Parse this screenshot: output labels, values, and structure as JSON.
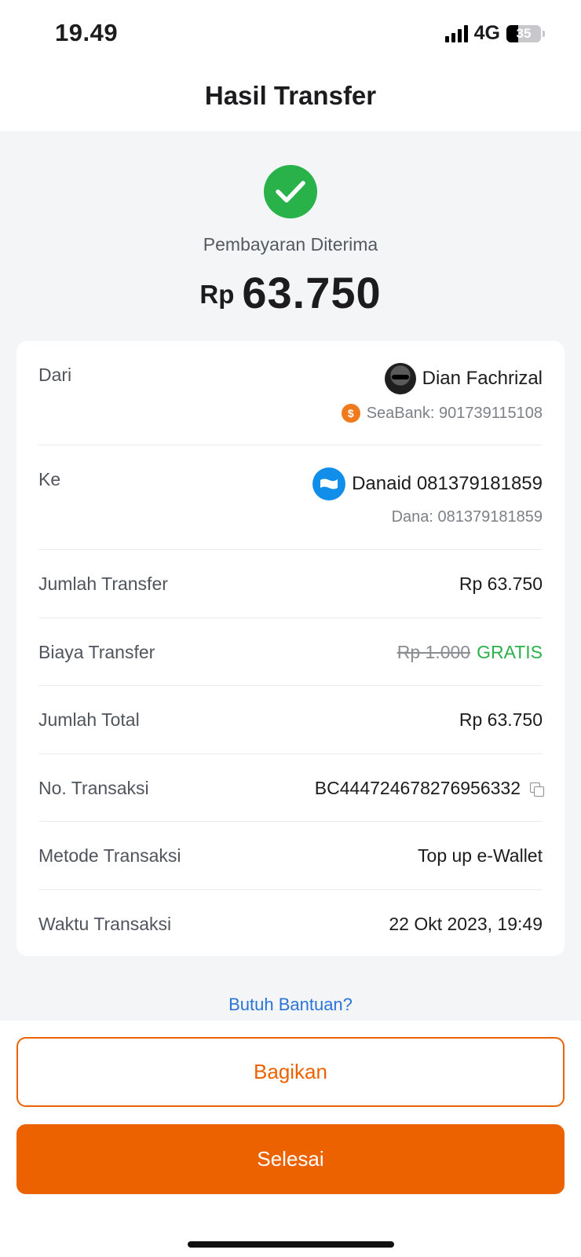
{
  "status_bar": {
    "time": "19.49",
    "network": "4G",
    "battery": "35",
    "battery_level": 0.35
  },
  "header": {
    "title": "Hasil Transfer"
  },
  "summary": {
    "status": "Pembayaran Diterima",
    "currency": "Rp",
    "amount": "63.750",
    "status_color": "#29b14a"
  },
  "details": {
    "from": {
      "label": "Dari",
      "name": "Dian Fachrizal",
      "account": "SeaBank: 901739115108",
      "bank_icon": "seabank-icon"
    },
    "to": {
      "label": "Ke",
      "name": "Danaid 081379181859",
      "account": "Dana: 081379181859",
      "wallet_icon": "dana-icon"
    },
    "amount": {
      "label": "Jumlah Transfer",
      "value": "Rp 63.750"
    },
    "fee": {
      "label": "Biaya Transfer",
      "original": "Rp 1.000",
      "value": "GRATIS"
    },
    "total": {
      "label": "Jumlah Total",
      "value": "Rp 63.750"
    },
    "transaction_no": {
      "label": "No. Transaksi",
      "value": "BC444724678276956332"
    },
    "method": {
      "label": "Metode Transaksi",
      "value": "Top up e-Wallet"
    },
    "time": {
      "label": "Waktu Transaksi",
      "value": "22 Okt 2023, 19:49"
    }
  },
  "help_link": "Butuh Bantuan?",
  "actions": {
    "share_label": "Bagikan",
    "done_label": "Selesai",
    "accent_color": "#ec6200"
  }
}
